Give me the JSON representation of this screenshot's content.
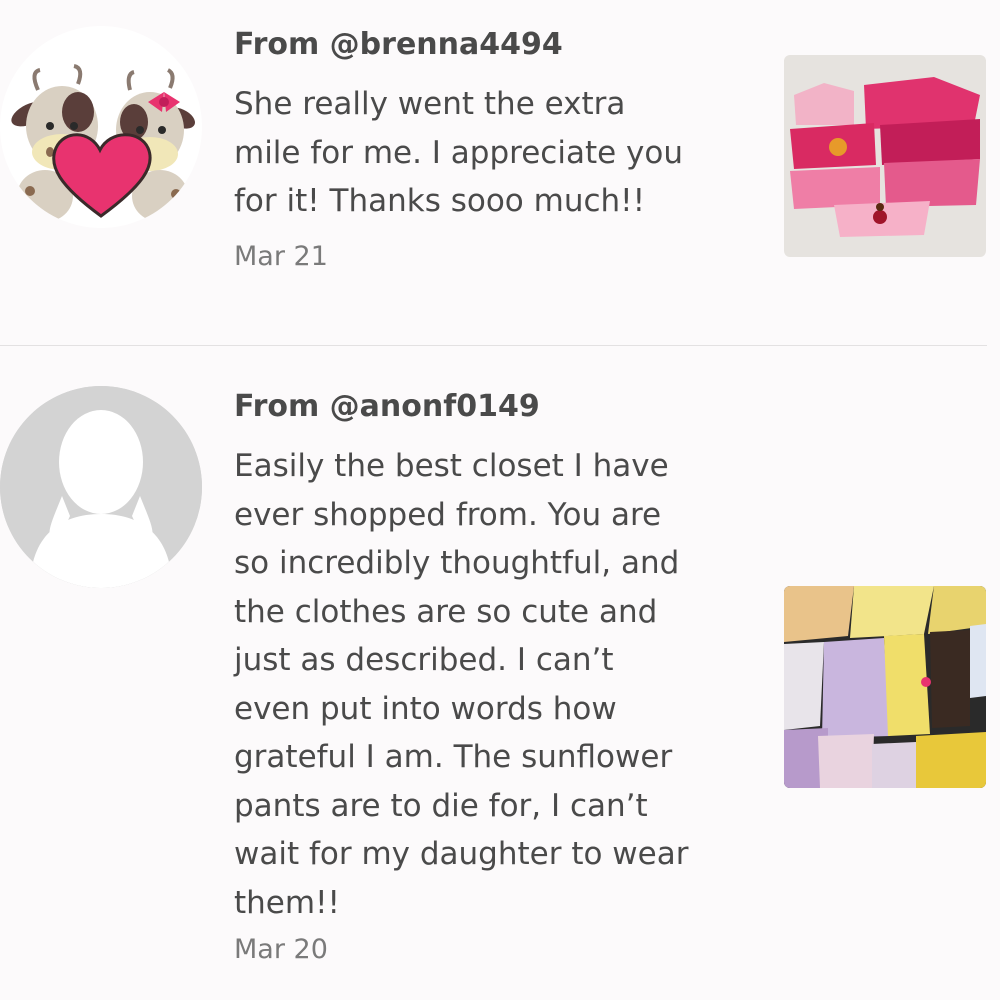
{
  "reviews": [
    {
      "author": "From @brenna4494",
      "comment_lines": [
        "She really went the extra",
        "mile for me. I appreciate you",
        "for it! Thanks sooo much!!"
      ],
      "date": "Mar 21",
      "avatar_icon": "cows-heart-avatar",
      "photo_icon": "pink-clothes-photo"
    },
    {
      "author": "From @anonf0149",
      "comment_lines": [
        "Easily the best closet I have",
        "ever shopped from. You are",
        "so incredibly thoughtful, and",
        "the clothes are so cute and",
        "just as described. I can’t",
        "even put into words how",
        "grateful I am. The sunflower",
        "pants are to die for, I can’t",
        "wait for my daughter to wear",
        "them!!"
      ],
      "date": "Mar 20",
      "avatar_icon": "default-person-avatar",
      "photo_icon": "yellow-purple-clothes-photo"
    }
  ],
  "colors": {
    "background": "#fcfafb",
    "text": "#4a4a4a",
    "date_text": "#7a7a7a",
    "divider": "#e3e1e2",
    "heart": "#e8336f",
    "default_avatar": "#d3d3d3"
  }
}
